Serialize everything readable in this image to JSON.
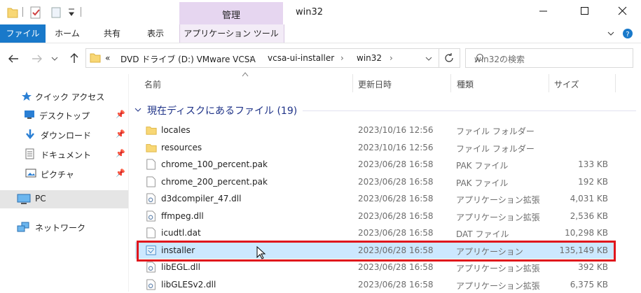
{
  "window": {
    "title": "win32",
    "context_tab": "管理",
    "accent": "#1979ca",
    "highlight_color": "#e0161c"
  },
  "ribbon": {
    "tabs": [
      "ファイル",
      "ホーム",
      "共有",
      "表示",
      "アプリケーション ツール"
    ]
  },
  "address": {
    "prefix": "«",
    "segments": [
      "DVD ドライブ (D:) VMware VCSA",
      "vcsa-ui-installer",
      "win32"
    ],
    "search_placeholder": "win32の検索"
  },
  "nav": {
    "items": [
      {
        "label": "クイック アクセス",
        "icon": "star-icon"
      },
      {
        "label": "デスクトップ",
        "icon": "desktop-icon"
      },
      {
        "label": "ダウンロード",
        "icon": "download-icon"
      },
      {
        "label": "ドキュメント",
        "icon": "document-icon"
      },
      {
        "label": "ピクチャ",
        "icon": "pictures-icon"
      },
      {
        "label": "PC",
        "icon": "pc-icon"
      },
      {
        "label": "ネットワーク",
        "icon": "network-icon"
      }
    ]
  },
  "list": {
    "columns": [
      "名前",
      "更新日時",
      "種類",
      "サイズ"
    ],
    "group_header": "現在ディスクにあるファイル (19)",
    "rows": [
      {
        "name": "locales",
        "date": "2023/10/16 12:56",
        "type": "ファイル フォルダー",
        "size": "",
        "icon": "folder-icon"
      },
      {
        "name": "resources",
        "date": "2023/10/16 12:56",
        "type": "ファイル フォルダー",
        "size": "",
        "icon": "folder-icon"
      },
      {
        "name": "chrome_100_percent.pak",
        "date": "2023/06/28 16:58",
        "type": "PAK ファイル",
        "size": "133 KB",
        "icon": "file-icon"
      },
      {
        "name": "chrome_200_percent.pak",
        "date": "2023/06/28 16:58",
        "type": "PAK ファイル",
        "size": "192 KB",
        "icon": "file-icon"
      },
      {
        "name": "d3dcompiler_47.dll",
        "date": "2023/06/28 16:58",
        "type": "アプリケーション拡張",
        "size": "4,031 KB",
        "icon": "dll-icon"
      },
      {
        "name": "ffmpeg.dll",
        "date": "2023/06/28 16:58",
        "type": "アプリケーション拡張",
        "size": "2,536 KB",
        "icon": "dll-icon"
      },
      {
        "name": "icudtl.dat",
        "date": "2023/06/28 16:58",
        "type": "DAT ファイル",
        "size": "10,298 KB",
        "icon": "file-icon"
      },
      {
        "name": "installer",
        "date": "2023/06/28 16:58",
        "type": "アプリケーション",
        "size": "135,149 KB",
        "icon": "app-icon"
      },
      {
        "name": "libEGL.dll",
        "date": "2023/06/28 16:58",
        "type": "アプリケーション拡張",
        "size": "392 KB",
        "icon": "dll-icon"
      },
      {
        "name": "libGLESv2.dll",
        "date": "2023/06/28 16:58",
        "type": "アプリケーション拡張",
        "size": "6,375 KB",
        "icon": "dll-icon"
      }
    ]
  }
}
